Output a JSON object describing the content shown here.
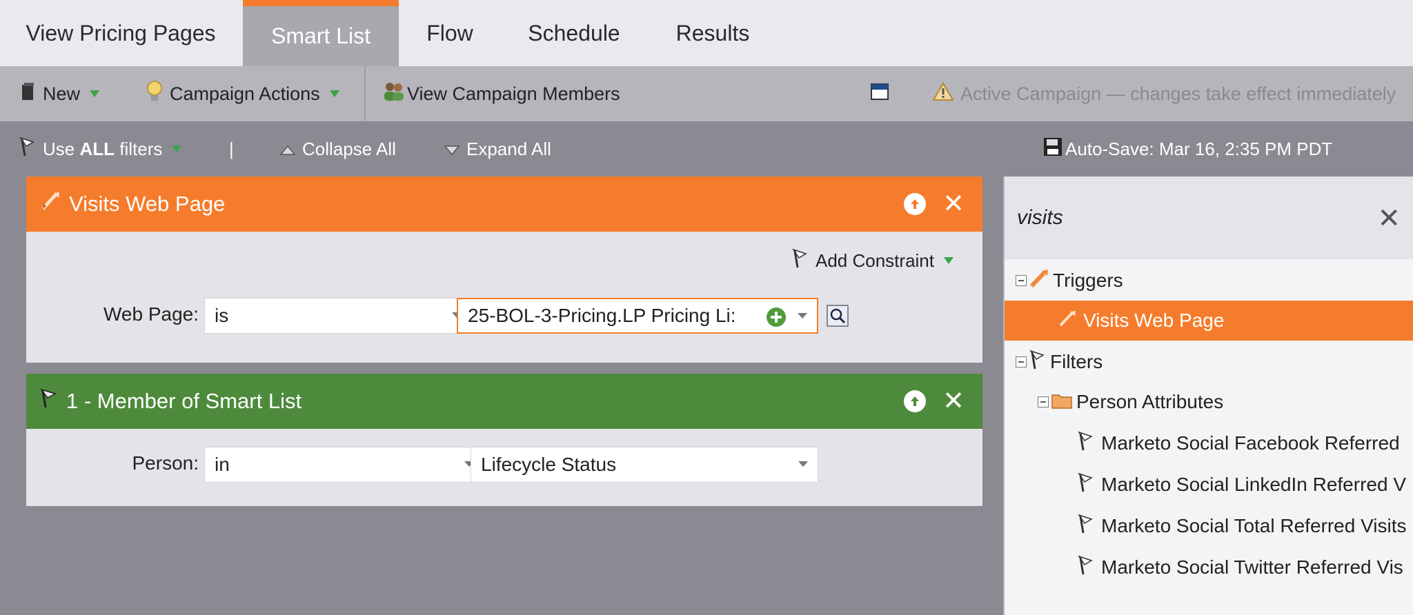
{
  "tabs": [
    {
      "label": "View Pricing Pages",
      "active": false
    },
    {
      "label": "Smart List",
      "active": true
    },
    {
      "label": "Flow",
      "active": false
    },
    {
      "label": "Schedule",
      "active": false
    },
    {
      "label": "Results",
      "active": false
    }
  ],
  "toolbar": {
    "new_label": "New",
    "campaign_actions_label": "Campaign Actions",
    "view_members_label": "View Campaign Members",
    "warning_text": "Active Campaign — changes take effect immediately"
  },
  "filterbar": {
    "use_prefix": "Use ",
    "use_bold": "ALL",
    "use_suffix": " filters",
    "separator": "|",
    "collapse_label": "Collapse All",
    "expand_label": "Expand All",
    "autosave_text": "Auto-Save: Mar 16, 2:35 PM PDT"
  },
  "trigger_card": {
    "title": "Visits Web Page",
    "add_constraint_label": "Add Constraint",
    "field_label": "Web Page:",
    "operator": "is",
    "value": "25-BOL-3-Pricing.LP Pricing Li:"
  },
  "filter_card": {
    "title": "1 - Member of Smart List",
    "field_label": "Person:",
    "operator": "in",
    "value": "Lifecycle Status"
  },
  "right_panel": {
    "search_value": "visits",
    "triggers_label": "Triggers",
    "trigger_item": "Visits Web Page",
    "filters_label": "Filters",
    "person_attributes_label": "Person Attributes",
    "filter_items": [
      "Marketo Social Facebook Referred",
      "Marketo Social LinkedIn Referred V",
      "Marketo Social Total Referred Visits",
      "Marketo Social Twitter Referred Vis"
    ]
  },
  "colors": {
    "accent_orange": "#f57c2c",
    "filter_green": "#4e8a3c",
    "caret_green": "#3aa34a"
  }
}
